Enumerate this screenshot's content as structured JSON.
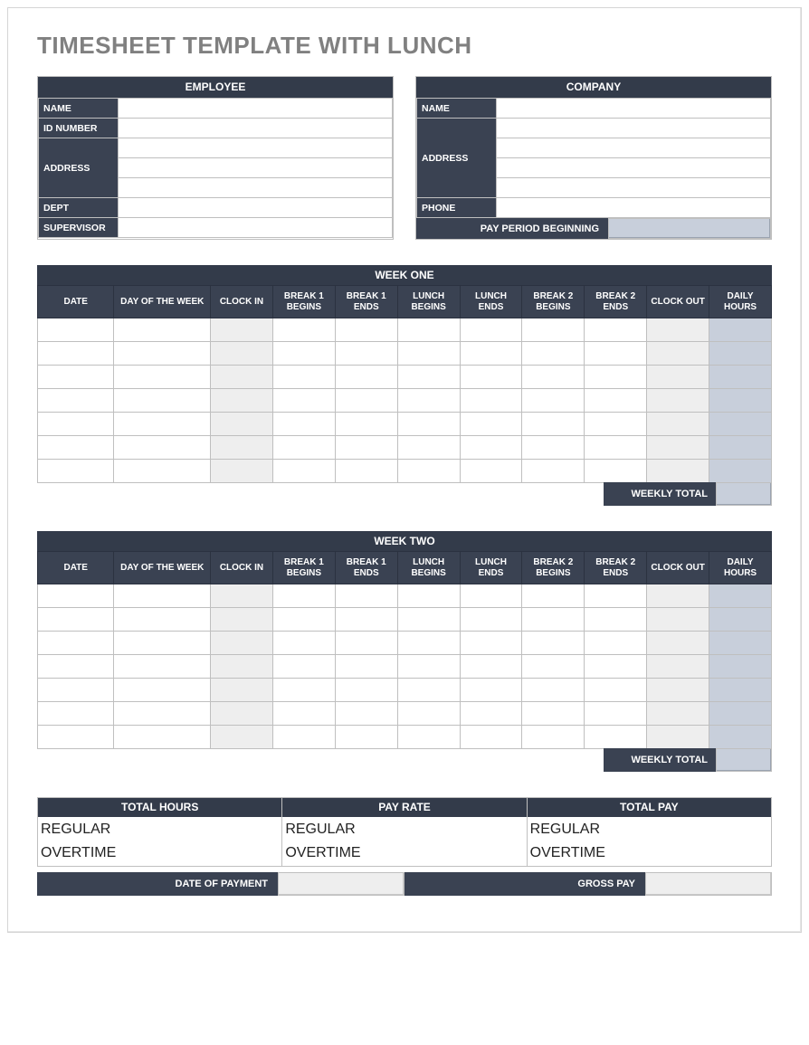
{
  "title": "TIMESHEET TEMPLATE WITH LUNCH",
  "employee": {
    "header": "EMPLOYEE",
    "labels": {
      "name": "NAME",
      "id": "ID NUMBER",
      "address": "ADDRESS",
      "dept": "DEPT",
      "supervisor": "SUPERVISOR"
    },
    "values": {
      "name": "",
      "id": "",
      "address1": "",
      "address2": "",
      "address3": "",
      "dept": "",
      "supervisor": ""
    }
  },
  "company": {
    "header": "COMPANY",
    "labels": {
      "name": "NAME",
      "address": "ADDRESS",
      "phone": "PHONE",
      "pay_period": "PAY PERIOD BEGINNING"
    },
    "values": {
      "name": "",
      "address1": "",
      "address2": "",
      "address3": "",
      "address4": "",
      "phone": "",
      "pay_period": ""
    }
  },
  "weeks": {
    "columns": [
      "DATE",
      "DAY OF THE WEEK",
      "CLOCK IN",
      "BREAK 1 BEGINS",
      "BREAK 1 ENDS",
      "LUNCH BEGINS",
      "LUNCH ENDS",
      "BREAK 2 BEGINS",
      "BREAK 2 ENDS",
      "CLOCK OUT",
      "DAILY HOURS"
    ],
    "weekly_total_label": "WEEKLY TOTAL",
    "one": {
      "title": "WEEK ONE",
      "rows": [
        {
          "date": "",
          "dow": "",
          "clock_in": "",
          "b1b": "",
          "b1e": "",
          "lb": "",
          "le": "",
          "b2b": "",
          "b2e": "",
          "clock_out": "",
          "daily": ""
        },
        {
          "date": "",
          "dow": "",
          "clock_in": "",
          "b1b": "",
          "b1e": "",
          "lb": "",
          "le": "",
          "b2b": "",
          "b2e": "",
          "clock_out": "",
          "daily": ""
        },
        {
          "date": "",
          "dow": "",
          "clock_in": "",
          "b1b": "",
          "b1e": "",
          "lb": "",
          "le": "",
          "b2b": "",
          "b2e": "",
          "clock_out": "",
          "daily": ""
        },
        {
          "date": "",
          "dow": "",
          "clock_in": "",
          "b1b": "",
          "b1e": "",
          "lb": "",
          "le": "",
          "b2b": "",
          "b2e": "",
          "clock_out": "",
          "daily": ""
        },
        {
          "date": "",
          "dow": "",
          "clock_in": "",
          "b1b": "",
          "b1e": "",
          "lb": "",
          "le": "",
          "b2b": "",
          "b2e": "",
          "clock_out": "",
          "daily": ""
        },
        {
          "date": "",
          "dow": "",
          "clock_in": "",
          "b1b": "",
          "b1e": "",
          "lb": "",
          "le": "",
          "b2b": "",
          "b2e": "",
          "clock_out": "",
          "daily": ""
        },
        {
          "date": "",
          "dow": "",
          "clock_in": "",
          "b1b": "",
          "b1e": "",
          "lb": "",
          "le": "",
          "b2b": "",
          "b2e": "",
          "clock_out": "",
          "daily": ""
        }
      ],
      "weekly_total": ""
    },
    "two": {
      "title": "WEEK TWO",
      "rows": [
        {
          "date": "",
          "dow": "",
          "clock_in": "",
          "b1b": "",
          "b1e": "",
          "lb": "",
          "le": "",
          "b2b": "",
          "b2e": "",
          "clock_out": "",
          "daily": ""
        },
        {
          "date": "",
          "dow": "",
          "clock_in": "",
          "b1b": "",
          "b1e": "",
          "lb": "",
          "le": "",
          "b2b": "",
          "b2e": "",
          "clock_out": "",
          "daily": ""
        },
        {
          "date": "",
          "dow": "",
          "clock_in": "",
          "b1b": "",
          "b1e": "",
          "lb": "",
          "le": "",
          "b2b": "",
          "b2e": "",
          "clock_out": "",
          "daily": ""
        },
        {
          "date": "",
          "dow": "",
          "clock_in": "",
          "b1b": "",
          "b1e": "",
          "lb": "",
          "le": "",
          "b2b": "",
          "b2e": "",
          "clock_out": "",
          "daily": ""
        },
        {
          "date": "",
          "dow": "",
          "clock_in": "",
          "b1b": "",
          "b1e": "",
          "lb": "",
          "le": "",
          "b2b": "",
          "b2e": "",
          "clock_out": "",
          "daily": ""
        },
        {
          "date": "",
          "dow": "",
          "clock_in": "",
          "b1b": "",
          "b1e": "",
          "lb": "",
          "le": "",
          "b2b": "",
          "b2e": "",
          "clock_out": "",
          "daily": ""
        },
        {
          "date": "",
          "dow": "",
          "clock_in": "",
          "b1b": "",
          "b1e": "",
          "lb": "",
          "le": "",
          "b2b": "",
          "b2e": "",
          "clock_out": "",
          "daily": ""
        }
      ],
      "weekly_total": ""
    }
  },
  "pay": {
    "total_hours": {
      "header": "TOTAL HOURS",
      "regular_label": "REGULAR",
      "overtime_label": "OVERTIME",
      "regular": "",
      "overtime": ""
    },
    "pay_rate": {
      "header": "PAY RATE",
      "regular_label": "REGULAR",
      "overtime_label": "OVERTIME",
      "regular": "",
      "overtime": ""
    },
    "total_pay": {
      "header": "TOTAL PAY",
      "regular_label": "REGULAR",
      "overtime_label": "OVERTIME",
      "regular": "",
      "overtime": ""
    }
  },
  "footer": {
    "date_of_payment_label": "DATE OF PAYMENT",
    "date_of_payment": "",
    "gross_pay_label": "GROSS PAY",
    "gross_pay": ""
  }
}
